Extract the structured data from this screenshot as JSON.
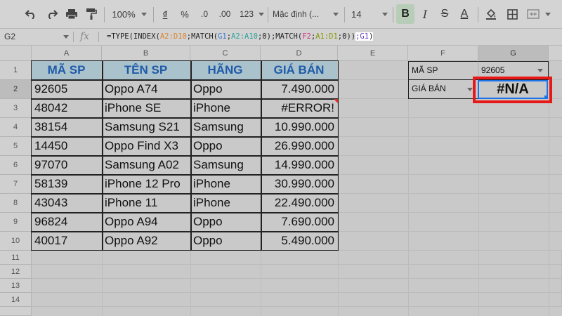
{
  "toolbar": {
    "zoom": "100%",
    "currency": "₫",
    "percent": "%",
    "dec_decrease": ".0",
    "dec_increase": ".00",
    "number_format": "123",
    "font_name": "Mặc định (...",
    "font_size": "14",
    "bold": "B",
    "italic": "I",
    "strike": "S",
    "text_color": "A"
  },
  "formula_bar": {
    "cell_ref": "G2",
    "fx": "fx",
    "formula_parts": [
      "=TYPE(INDEX(",
      "A2:D10",
      ";MATCH(",
      "G1",
      ";",
      "A2:A10",
      ";0);MATCH(",
      "F2",
      ";",
      "A1:D1",
      ";0))",
      ";G1",
      ")"
    ]
  },
  "columns": [
    "A",
    "B",
    "C",
    "D",
    "E",
    "F",
    "G"
  ],
  "rows": [
    "1",
    "2",
    "3",
    "4",
    "5",
    "6",
    "7",
    "8",
    "9",
    "10",
    "11",
    "12",
    "13",
    "14"
  ],
  "table": {
    "headers": [
      "MÃ SP",
      "TÊN SP",
      "HÃNG",
      "GIÁ BÁN"
    ],
    "data": [
      [
        "92605",
        "Oppo A74",
        "Oppo",
        "7.490.000"
      ],
      [
        "48042",
        "iPhone SE",
        "iPhone",
        "#ERROR!"
      ],
      [
        "38154",
        "Samsung S21",
        "Samsung",
        "10.990.000"
      ],
      [
        "14450",
        "Oppo Find X3",
        "Oppo",
        "26.990.000"
      ],
      [
        "97070",
        "Samsung A02",
        "Samsung",
        "14.990.000"
      ],
      [
        "58139",
        "iPhone 12 Pro",
        "iPhone",
        "30.990.000"
      ],
      [
        "43043",
        "iPhone 11",
        "iPhone",
        "22.490.000"
      ],
      [
        "96824",
        "Oppo A94",
        "Oppo",
        "7.690.000"
      ],
      [
        "40017",
        "Oppo A92",
        "Oppo",
        "5.490.000"
      ]
    ]
  },
  "lookup": {
    "f1": "MÃ SP",
    "g1": "92605",
    "f2": "GIÁ BÁN",
    "g2": "#N/A"
  },
  "colors": {
    "header_fill": "#a9c2cc",
    "header_text": "#1f5aa8",
    "selection": "#1a73e8",
    "highlight_box": "#e81818"
  }
}
